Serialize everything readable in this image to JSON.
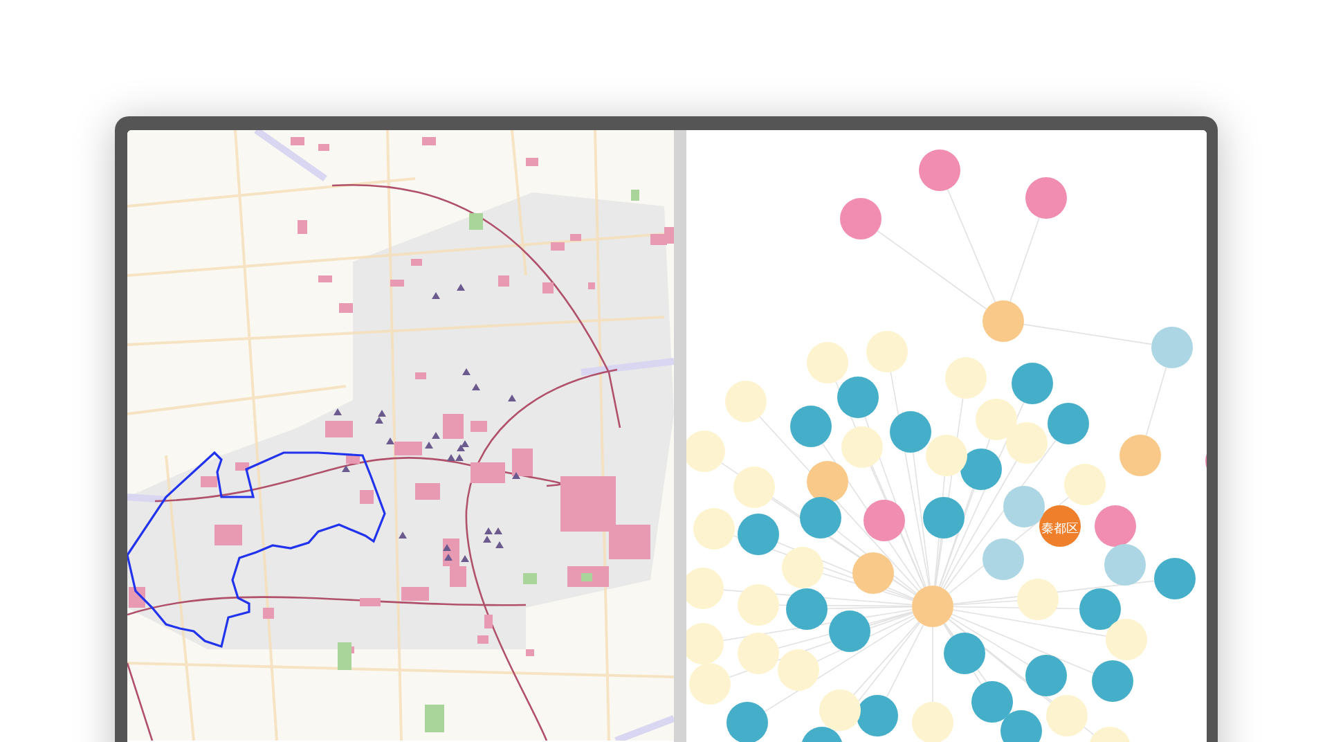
{
  "graph": {
    "nodes": [
      {
        "color": "#f08db0"
      },
      {
        "color": "#f08db0"
      },
      {
        "color": "#f08db0"
      },
      {
        "color": "#f08db0"
      },
      {
        "color": "#f08db0"
      },
      {
        "color": "#f08db0"
      },
      {
        "color": "#f9c98a"
      },
      {
        "color": "#f9c98a"
      },
      {
        "color": "#f9c98a"
      },
      {
        "color": "#f9c98a"
      },
      {
        "color": "#f9c98a"
      },
      {
        "color": "#f07f2c",
        "label": "秦都区"
      },
      {
        "color": "#acd6e4"
      },
      {
        "color": "#acd6e4"
      },
      {
        "color": "#acd6e4"
      },
      {
        "color": "#acd6e4"
      },
      {
        "color": "#45afca"
      },
      {
        "color": "#45afca"
      },
      {
        "color": "#45afca"
      },
      {
        "color": "#45afca"
      },
      {
        "color": "#45afca"
      },
      {
        "color": "#45afca"
      },
      {
        "color": "#45afca"
      },
      {
        "color": "#45afca"
      },
      {
        "color": "#45afca"
      },
      {
        "color": "#45afca"
      },
      {
        "color": "#45afca"
      },
      {
        "color": "#45afca"
      },
      {
        "color": "#45afca"
      },
      {
        "color": "#45afca"
      },
      {
        "color": "#45afca"
      },
      {
        "color": "#45afca"
      },
      {
        "color": "#45afca"
      },
      {
        "color": "#45afca"
      },
      {
        "color": "#45afca"
      },
      {
        "color": "#45afca"
      },
      {
        "color": "#45afca"
      },
      {
        "color": "#fdf4cf"
      },
      {
        "color": "#fdf4cf"
      },
      {
        "color": "#fdf4cf"
      },
      {
        "color": "#fdf4cf"
      },
      {
        "color": "#fdf4cf"
      },
      {
        "color": "#fdf4cf"
      },
      {
        "color": "#fdf4cf"
      },
      {
        "color": "#fdf4cf"
      },
      {
        "color": "#fdf4cf"
      },
      {
        "color": "#fdf4cf"
      },
      {
        "color": "#fdf4cf"
      },
      {
        "color": "#fdf4cf"
      },
      {
        "color": "#fdf4cf"
      },
      {
        "color": "#fdf4cf"
      },
      {
        "color": "#fdf4cf"
      },
      {
        "color": "#fdf4cf"
      },
      {
        "color": "#fdf4cf"
      },
      {
        "color": "#fdf4cf"
      },
      {
        "color": "#fdf4cf"
      },
      {
        "color": "#fdf4cf"
      },
      {
        "color": "#fdf4cf"
      },
      {
        "color": "#fdf4cf"
      },
      {
        "color": "#fdf4cf"
      },
      {
        "color": "#fdf4cf"
      },
      {
        "color": "#fdf4cf"
      }
    ]
  }
}
